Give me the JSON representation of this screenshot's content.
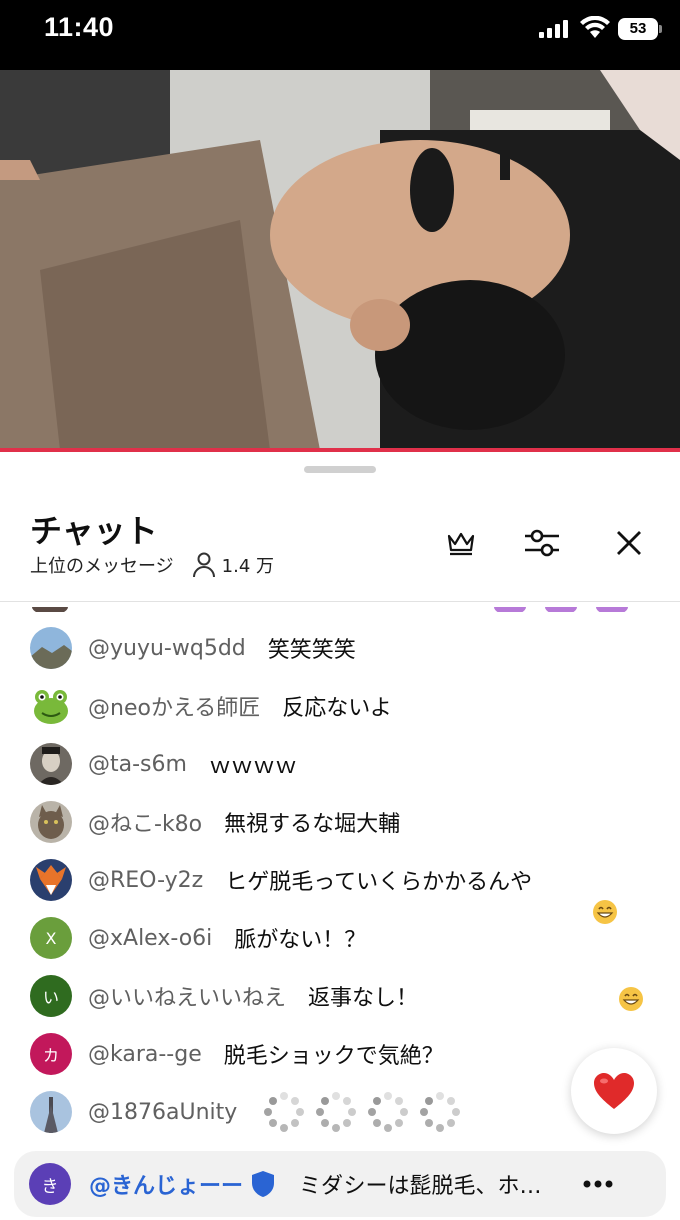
{
  "status_bar": {
    "time": "11:40",
    "battery": "53"
  },
  "chat": {
    "title": "チャット",
    "mode_label": "上位のメッセージ",
    "viewer_count": "1.4 万"
  },
  "messages": [
    {
      "author": "@yuyu-wq5dd",
      "text": "笑笑笑笑",
      "avatar": "landscape"
    },
    {
      "author": "@neoかえる師匠",
      "text": "反応ないよ",
      "avatar": "frog"
    },
    {
      "author": "@ta-s6m",
      "text": "ｗｗｗｗ",
      "avatar": "portrait"
    },
    {
      "author": "@ねこ-k8o",
      "text": "無視するな堀大輔",
      "avatar": "cat"
    },
    {
      "author": "@REO-y2z",
      "text": "ヒゲ脱毛っていくらかかるんや",
      "avatar": "fox"
    },
    {
      "author": "@xAlex-o6i",
      "text": "脈がない！？",
      "avatar_letter": "X",
      "avatar_color": "#6a9e3c"
    },
    {
      "author": "@いいねえいいねえ",
      "text": "返事なし！",
      "avatar_letter": "い",
      "avatar_color": "#2f6b1f"
    },
    {
      "author": "@kara--ge",
      "text": "脱毛ショックで気絶？",
      "avatar_letter": "カ",
      "avatar_color": "#c2185b"
    },
    {
      "author": "@1876aUnity",
      "text": "",
      "avatar": "tower",
      "loading_placeholders": 4
    }
  ],
  "pinned": {
    "avatar_letter": "き",
    "author": "@きんじょーー",
    "text": "ミダシーは髭脱毛、ホ…"
  },
  "colors": {
    "accent_red": "#e0304a",
    "pinned_author": "#2a64d3"
  }
}
